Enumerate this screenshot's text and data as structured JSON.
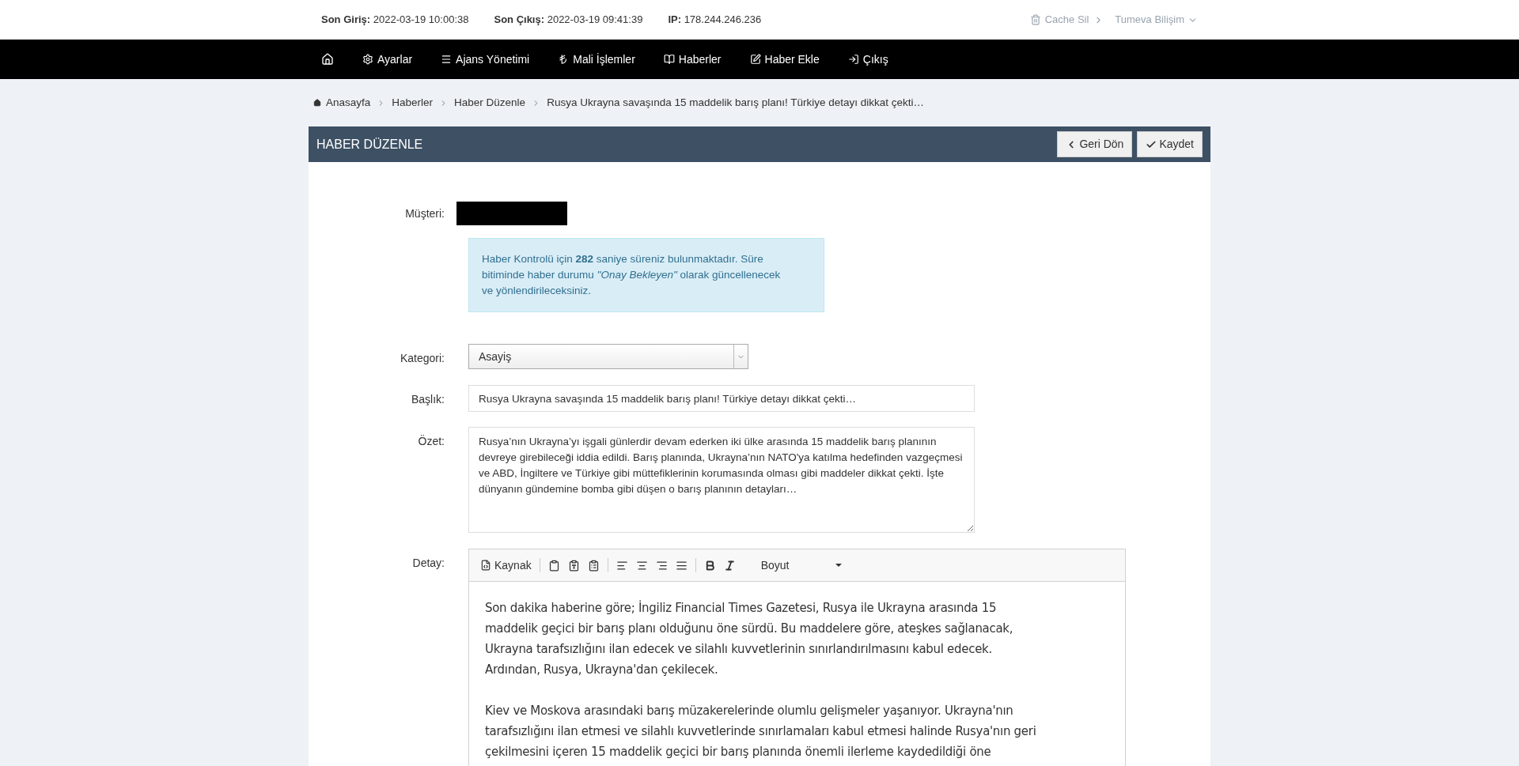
{
  "top_bar": {
    "info": [
      {
        "label": "Son Giriş:",
        "value": "2022-03-19 10:00:38"
      },
      {
        "label": "Son Çıkış:",
        "value": "2022-03-19 09:41:39"
      },
      {
        "label": "IP:",
        "value": "178.244.246.236"
      }
    ],
    "cache_button": "Cache Sil",
    "user_menu": "Tumeva Bilişim"
  },
  "nav": {
    "items": [
      "Ayarlar",
      "Ajans Yönetimi",
      "Mali İşlemler",
      "Haberler",
      "Haber Ekle",
      "Çıkış"
    ]
  },
  "breadcrumb": [
    "Anasayfa",
    "Haberler",
    "Haber Düzenle",
    "Rusya Ukrayna savaşında 15 maddelik barış planı! Türkiye detayı dikkat çekti…"
  ],
  "panel": {
    "title": "HABER DÜZENLE",
    "buttons": [
      "Geri Dön",
      "Kaydet"
    ]
  },
  "form": {
    "customer_label": "Müşteri:",
    "alert": "Haber Kontrolü için **282** saniye süreniz bulunmaktadır. Süre bitiminde haber durumu *\"Onay Bekleyen\"* olarak güncellenecek ve yönlendirileceksiniz.",
    "category": {
      "label": "Kategori:",
      "value": "Asayiş"
    },
    "title": {
      "label": "Başlık:",
      "value": "Rusya Ukrayna savaşında 15 maddelik barış planı! Türkiye detayı dikkat çekti…"
    },
    "summary": {
      "label": "Özet:",
      "value": "Rusya’nın Ukrayna’yı işgali günlerdir devam ederken iki ülke arasında 15 maddelik barış planının devreye girebileceği iddia edildi. Barış planında, Ukrayna’nın NATO'ya katılma hedefinden vazgeçmesi ve ABD, İngiltere ve Türkiye gibi müttefiklerinin korumasında olması gibi maddeler dikkat çekti. İşte dünyanın gündemine bomba gibi düşen o barış planının detayları…"
    },
    "detail": {
      "label": "Detay:",
      "source_button": "Kaynak",
      "size_dropdown": "Boyut",
      "paragraphs": [
        "Son dakika haberine göre; İngiliz Financial Times Gazetesi, Rusya ile Ukrayna arasında 15 maddelik geçici bir barış planı olduğunu öne sürdü. Bu maddelere göre, ateşkes sağlanacak, Ukrayna tarafsızlığını ilan edecek ve silahlı kuvvetlerinin sınırlandırılmasını kabul edecek. Ardından, Rusya, Ukrayna'dan çekilecek.",
        "Kiev ve Moskova arasındaki barış müzakerelerinde olumlu gelişmeler yaşanıyor. Ukrayna'nın tarafsızlığını ilan etmesi ve silahlı kuvvetlerinde sınırlamaları kabul etmesi halinde Rusya'nın geri çekilmesini içeren 15 maddelik geçici bir barış planında önemli ilerleme kaydedildiği öne"
      ]
    }
  }
}
